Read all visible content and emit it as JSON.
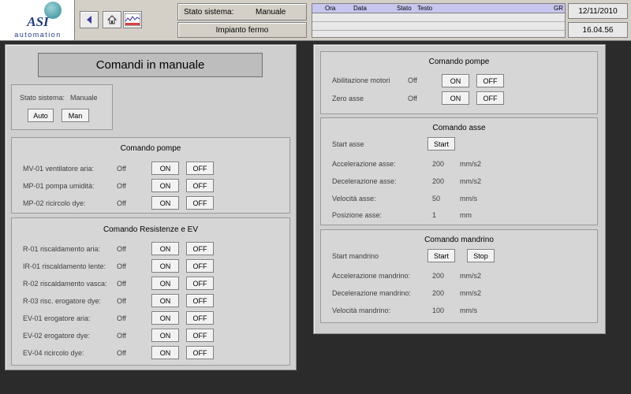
{
  "header": {
    "logo_name": "ASI",
    "logo_sub": "automation",
    "stato_label": "Stato sistema:",
    "stato_value": "Manuale",
    "impianto": "Impianto fermo",
    "alarm_columns": [
      "Ora",
      "Data",
      "Stato",
      "Testo",
      "GR"
    ],
    "date": "12/11/2010",
    "time": "16.04.56"
  },
  "left": {
    "title": "Comandi in manuale",
    "mode": {
      "label": "Stato sistema:",
      "value": "Manuale",
      "auto_label": "Auto",
      "man_label": "Man"
    },
    "pompe": {
      "title": "Comando  pompe",
      "rows": [
        {
          "label": "MV-01 ventilatore aria:",
          "state": "Off",
          "on": "ON",
          "off": "OFF"
        },
        {
          "label": "MP-01 pompa umidità:",
          "state": "Off",
          "on": "ON",
          "off": "OFF"
        },
        {
          "label": "MP-02 ricircolo  dye:",
          "state": "Off",
          "on": "ON",
          "off": "OFF"
        }
      ]
    },
    "resistenze": {
      "title": "Comando Resistenze e EV",
      "rows": [
        {
          "label": "R-01 riscaldamento aria:",
          "state": "Off",
          "on": "ON",
          "off": "OFF"
        },
        {
          "label": "IR-01 riscaldamento lente:",
          "state": "Off",
          "on": "ON",
          "off": "OFF"
        },
        {
          "label": "R-02 riscaldamento vasca:",
          "state": "Off",
          "on": "ON",
          "off": "OFF"
        },
        {
          "label": "R-03 risc. erogatore dye:",
          "state": "Off",
          "on": "ON",
          "off": "OFF"
        },
        {
          "label": "EV-01 erogatore aria:",
          "state": "Off",
          "on": "ON",
          "off": "OFF"
        },
        {
          "label": "EV-02 erogatore dye:",
          "state": "Off",
          "on": "ON",
          "off": "OFF"
        },
        {
          "label": "EV-04 ricircolo dye:",
          "state": "Off",
          "on": "ON",
          "off": "OFF"
        }
      ]
    }
  },
  "right": {
    "pompe": {
      "title": "Comando  pompe",
      "rows": [
        {
          "label": "Abilitazione motori",
          "state": "Off",
          "on": "ON",
          "off": "OFF"
        },
        {
          "label": "Zero asse",
          "state": "Off",
          "on": "ON",
          "off": "OFF"
        }
      ]
    },
    "asse": {
      "title": "Comando  asse",
      "start_label": "Start asse",
      "start_button": "Start",
      "rows": [
        {
          "label": "Accelerazione asse:",
          "value": "200",
          "unit": "mm/s2"
        },
        {
          "label": "Decelerazione asse:",
          "value": "200",
          "unit": "mm/s2"
        },
        {
          "label": "Velocità asse:",
          "value": "50",
          "unit": "mm/s"
        },
        {
          "label": "Posizione asse:",
          "value": "1",
          "unit": "mm"
        }
      ]
    },
    "mandrino": {
      "title": "Comando  mandrino",
      "start_label": "Start mandrino",
      "start_button": "Start",
      "stop_button": "Stop",
      "rows": [
        {
          "label": "Accelerazione mandrino:",
          "value": "200",
          "unit": "mm/s2"
        },
        {
          "label": "Decelerazione mandrino:",
          "value": "200",
          "unit": "mm/s2"
        },
        {
          "label": "Velocità mandrino:",
          "value": "100",
          "unit": "mm/s"
        }
      ]
    }
  }
}
